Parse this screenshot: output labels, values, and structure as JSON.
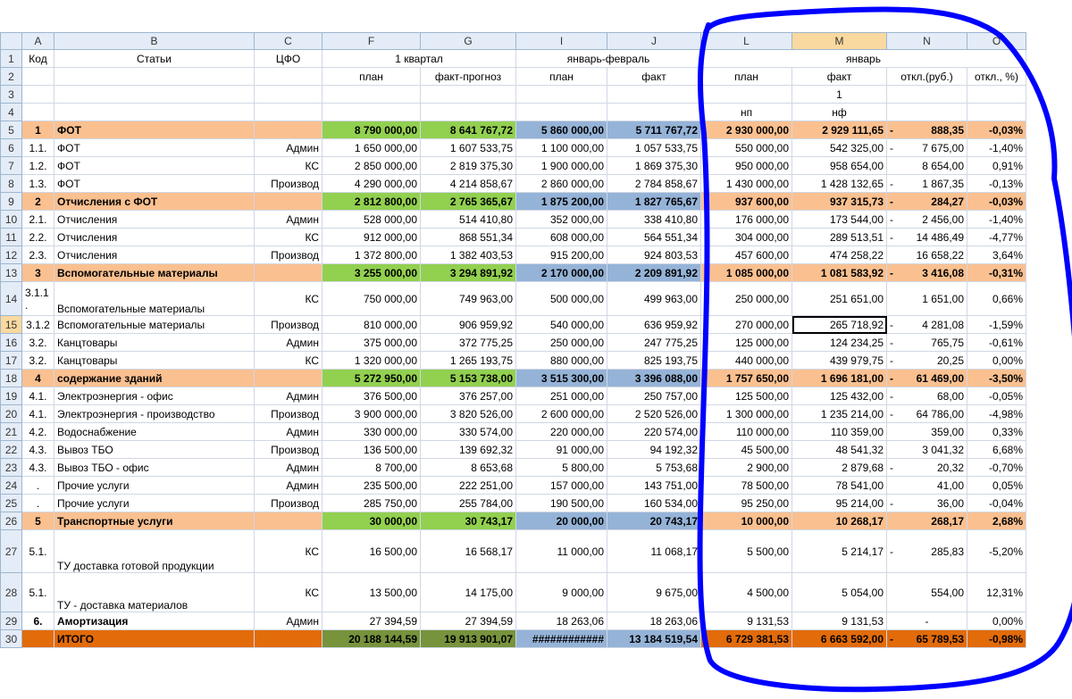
{
  "columns": [
    "A",
    "B",
    "C",
    "F",
    "G",
    "I",
    "J",
    "L",
    "M",
    "N",
    "O"
  ],
  "selected_column": "M",
  "selected_row": "15",
  "header_rows": [
    {
      "row": "1",
      "cells": [
        "Код",
        "Статьи",
        "ЦФО",
        "1 квартал",
        "",
        "январь-февраль",
        "",
        "",
        "январь",
        "",
        ""
      ]
    },
    {
      "row": "2",
      "cells": [
        "",
        "",
        "",
        "план",
        "факт-прогноз",
        "план",
        "факт",
        "план",
        "факт",
        "откл.(руб.)",
        "откл., %)"
      ]
    },
    {
      "row": "3",
      "cells": [
        "",
        "",
        "",
        "",
        "",
        "",
        "",
        "",
        "1",
        "",
        ""
      ]
    },
    {
      "row": "4",
      "cells": [
        "",
        "",
        "",
        "",
        "",
        "",
        "",
        "нп",
        "нф",
        "",
        ""
      ]
    }
  ],
  "data_rows": [
    {
      "row": "5",
      "type": "grp",
      "code": "1",
      "name": "ФОТ",
      "cfo": "",
      "f": "8 790 000,00",
      "g": "8 641 767,72",
      "i": "5 860 000,00",
      "j": "5 711 767,72",
      "l": "2 930 000,00",
      "m": "2 929 111,65",
      "n_sign": "-",
      "n": "888,35",
      "o": "-0,03%"
    },
    {
      "row": "6",
      "type": "",
      "code": "1.1.",
      "name": "ФОТ",
      "cfo": "Админ",
      "f": "1 650 000,00",
      "g": "1 607 533,75",
      "i": "1 100 000,00",
      "j": "1 057 533,75",
      "l": "550 000,00",
      "m": "542 325,00",
      "n_sign": "-",
      "n": "7 675,00",
      "o": "-1,40%"
    },
    {
      "row": "7",
      "type": "",
      "code": "1.2.",
      "name": "ФОТ",
      "cfo": "КС",
      "f": "2 850 000,00",
      "g": "2 819 375,30",
      "i": "1 900 000,00",
      "j": "1 869 375,30",
      "l": "950 000,00",
      "m": "958 654,00",
      "n_sign": "",
      "n": "8 654,00",
      "o": "0,91%"
    },
    {
      "row": "8",
      "type": "",
      "code": "1.3.",
      "name": "ФОТ",
      "cfo": "Производ",
      "f": "4 290 000,00",
      "g": "4 214 858,67",
      "i": "2 860 000,00",
      "j": "2 784 858,67",
      "l": "1 430 000,00",
      "m": "1 428 132,65",
      "n_sign": "-",
      "n": "1 867,35",
      "o": "-0,13%"
    },
    {
      "row": "9",
      "type": "grp",
      "code": "2",
      "name": "Отчисления с ФОТ",
      "cfo": "",
      "f": "2 812 800,00",
      "g": "2 765 365,67",
      "i": "1 875 200,00",
      "j": "1 827 765,67",
      "l": "937 600,00",
      "m": "937 315,73",
      "n_sign": "-",
      "n": "284,27",
      "o": "-0,03%"
    },
    {
      "row": "10",
      "type": "",
      "code": "2.1.",
      "name": "Отчисления",
      "cfo": "Админ",
      "f": "528 000,00",
      "g": "514 410,80",
      "i": "352 000,00",
      "j": "338 410,80",
      "l": "176 000,00",
      "m": "173 544,00",
      "n_sign": "-",
      "n": "2 456,00",
      "o": "-1,40%"
    },
    {
      "row": "11",
      "type": "",
      "code": "2.2.",
      "name": "Отчисления",
      "cfo": "КС",
      "f": "912 000,00",
      "g": "868 551,34",
      "i": "608 000,00",
      "j": "564 551,34",
      "l": "304 000,00",
      "m": "289 513,51",
      "n_sign": "-",
      "n": "14 486,49",
      "o": "-4,77%"
    },
    {
      "row": "12",
      "type": "",
      "code": "2.3.",
      "name": "Отчисления",
      "cfo": "Производ",
      "f": "1 372 800,00",
      "g": "1 382 403,53",
      "i": "915 200,00",
      "j": "924 803,53",
      "l": "457 600,00",
      "m": "474 258,22",
      "n_sign": "",
      "n": "16 658,22",
      "o": "3,64%"
    },
    {
      "row": "13",
      "type": "grp",
      "code": "3",
      "name": "Вспомогательные материалы",
      "cfo": "",
      "f": "3 255 000,00",
      "g": "3 294 891,92",
      "i": "2 170 000,00",
      "j": "2 209 891,92",
      "l": "1 085 000,00",
      "m": "1 081 583,92",
      "n_sign": "-",
      "n": "3 416,08",
      "o": "-0,31%"
    },
    {
      "row": "14",
      "type": "tall",
      "code": "3.1.1 .",
      "name": "Вспомогательные материалы",
      "cfo": "КС",
      "f": "750 000,00",
      "g": "749 963,00",
      "i": "500 000,00",
      "j": "499 963,00",
      "l": "250 000,00",
      "m": "251 651,00",
      "n_sign": "",
      "n": "1 651,00",
      "o": "0,66%"
    },
    {
      "row": "15",
      "type": "",
      "code": "3.1.2",
      "name": "Вспомогательные материалы",
      "cfo": "Производ",
      "f": "810 000,00",
      "g": "906 959,92",
      "i": "540 000,00",
      "j": "636 959,92",
      "l": "270 000,00",
      "m": "265 718,92",
      "n_sign": "-",
      "n": "4 281,08",
      "o": "-1,59%"
    },
    {
      "row": "16",
      "type": "",
      "code": "3.2.",
      "name": "Канцтовары",
      "cfo": "Админ",
      "f": "375 000,00",
      "g": "372 775,25",
      "i": "250 000,00",
      "j": "247 775,25",
      "l": "125 000,00",
      "m": "124 234,25",
      "n_sign": "-",
      "n": "765,75",
      "o": "-0,61%"
    },
    {
      "row": "17",
      "type": "",
      "code": "3.2.",
      "name": "Канцтовары",
      "cfo": "КС",
      "f": "1 320 000,00",
      "g": "1 265 193,75",
      "i": "880 000,00",
      "j": "825 193,75",
      "l": "440 000,00",
      "m": "439 979,75",
      "n_sign": "-",
      "n": "20,25",
      "o": "0,00%"
    },
    {
      "row": "18",
      "type": "grp",
      "code": "4",
      "name": "содержание зданий",
      "cfo": "",
      "f": "5 272 950,00",
      "g": "5 153 738,00",
      "i": "3 515 300,00",
      "j": "3 396 088,00",
      "l": "1 757 650,00",
      "m": "1 696 181,00",
      "n_sign": "-",
      "n": "61 469,00",
      "o": "-3,50%"
    },
    {
      "row": "19",
      "type": "",
      "code": "4.1.",
      "name": "Электроэнергия - офис",
      "cfo": "Админ",
      "f": "376 500,00",
      "g": "376 257,00",
      "i": "251 000,00",
      "j": "250 757,00",
      "l": "125 500,00",
      "m": "125 432,00",
      "n_sign": "-",
      "n": "68,00",
      "o": "-0,05%"
    },
    {
      "row": "20",
      "type": "",
      "code": "4.1.",
      "name": "Электроэнергия - производство",
      "cfo": "Производ",
      "f": "3 900 000,00",
      "g": "3 820 526,00",
      "i": "2 600 000,00",
      "j": "2 520 526,00",
      "l": "1 300 000,00",
      "m": "1 235 214,00",
      "n_sign": "-",
      "n": "64 786,00",
      "o": "-4,98%"
    },
    {
      "row": "21",
      "type": "",
      "code": "4.2.",
      "name": "Водоснабжение",
      "cfo": "Админ",
      "f": "330 000,00",
      "g": "330 574,00",
      "i": "220 000,00",
      "j": "220 574,00",
      "l": "110 000,00",
      "m": "110 359,00",
      "n_sign": "",
      "n": "359,00",
      "o": "0,33%"
    },
    {
      "row": "22",
      "type": "",
      "code": "4.3.",
      "name": "Вывоз ТБО",
      "cfo": "Производ",
      "f": "136 500,00",
      "g": "139 692,32",
      "i": "91 000,00",
      "j": "94 192,32",
      "l": "45 500,00",
      "m": "48 541,32",
      "n_sign": "",
      "n": "3 041,32",
      "o": "6,68%"
    },
    {
      "row": "23",
      "type": "",
      "code": "4.3.",
      "name": "Вывоз ТБО - офис",
      "cfo": "Админ",
      "f": "8 700,00",
      "g": "8 653,68",
      "i": "5 800,00",
      "j": "5 753,68",
      "l": "2 900,00",
      "m": "2 879,68",
      "n_sign": "-",
      "n": "20,32",
      "o": "-0,70%"
    },
    {
      "row": "24",
      "type": "",
      "code": ".",
      "name": "Прочие услуги",
      "cfo": "Админ",
      "f": "235 500,00",
      "g": "222 251,00",
      "i": "157 000,00",
      "j": "143 751,00",
      "l": "78 500,00",
      "m": "78 541,00",
      "n_sign": "",
      "n": "41,00",
      "o": "0,05%"
    },
    {
      "row": "25",
      "type": "",
      "code": ".",
      "name": "Прочие услуги",
      "cfo": "Производ",
      "f": "285 750,00",
      "g": "255 784,00",
      "i": "190 500,00",
      "j": "160 534,00",
      "l": "95 250,00",
      "m": "95 214,00",
      "n_sign": "-",
      "n": "36,00",
      "o": "-0,04%"
    },
    {
      "row": "26",
      "type": "grp",
      "code": "5",
      "name": "Транспортные услуги",
      "cfo": "",
      "f": "30 000,00",
      "g": "30 743,17",
      "i": "20 000,00",
      "j": "20 743,17",
      "l": "10 000,00",
      "m": "10 268,17",
      "n_sign": "",
      "n": "268,17",
      "o": "2,68%"
    },
    {
      "row": "27",
      "type": "tall",
      "code": "5.1.",
      "name": "ТУ доставка готовой продукции",
      "cfo": "КС",
      "f": "16 500,00",
      "g": "16 568,17",
      "i": "11 000,00",
      "j": "11 068,17",
      "l": "5 500,00",
      "m": "5 214,17",
      "n_sign": "-",
      "n": "285,83",
      "o": "-5,20%"
    },
    {
      "row": "28",
      "type": "tall",
      "code": "5.1.",
      "name": "ТУ - доставка материалов",
      "cfo": "КС",
      "f": "13 500,00",
      "g": "14 175,00",
      "i": "9 000,00",
      "j": "9 675,00",
      "l": "4 500,00",
      "m": "5 054,00",
      "n_sign": "",
      "n": "554,00",
      "o": "12,31%"
    },
    {
      "row": "29",
      "type": "bold",
      "code": "6.",
      "name": "Амортизация",
      "cfo": "Админ",
      "f": "27 394,59",
      "g": "27 394,59",
      "i": "18 263,06",
      "j": "18 263,06",
      "l": "9 131,53",
      "m": "9 131,53",
      "n_sign": "",
      "n": "-",
      "o": "0,00%"
    },
    {
      "row": "30",
      "type": "tot",
      "code": "",
      "name": "ИТОГО",
      "cfo": "",
      "f": "20 188 144,59",
      "g": "19 913 901,07",
      "i": "############",
      "j": "13 184 519,54",
      "l": "6 729 381,53",
      "m": "6 663 592,00",
      "n_sign": "-",
      "n": "65 789,53",
      "o": "-0,98%"
    }
  ],
  "colors": {
    "group_fill": "#fac090",
    "group_plan_fill": "#92d050",
    "group_jan_feb_fill": "#95b3d7",
    "total_fill": "#e26b0a",
    "scribble": "#0000ff",
    "header_fill": "#e4ecf7",
    "selected_header_fill": "#f9d99f"
  }
}
